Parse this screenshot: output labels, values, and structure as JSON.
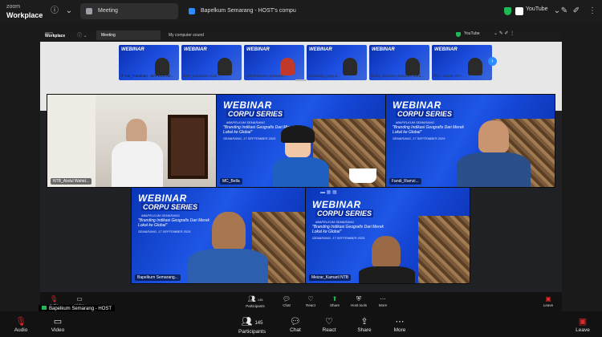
{
  "app": {
    "brand_line1": "zoom",
    "brand_line2": "Workplace"
  },
  "tabs": [
    {
      "label": "Meeting"
    },
    {
      "label": "Bapelkum Semarang - HOST's compu"
    }
  ],
  "topright": {
    "youtube": "YouTube"
  },
  "inner": {
    "brand_line1": "zoom",
    "brand_line2": "Workplace",
    "tab_meeting": "Meeting",
    "tab_screen": "My computer sound",
    "youtube": "YouTube"
  },
  "filmstrip": {
    "names": [
      "IT Gal_Frandrian - BAPELKUM...",
      "NTB_Kurniaban Sule...",
      "Luth Rahman-Sulawesi...",
      "Semarang_Bagus...",
      "Budhi_Satrianto-Sulawesi Bara...",
      "Pho - Kawan DIY..."
    ]
  },
  "webinar": {
    "title": "WEBINAR",
    "series": "CORPU SERIES",
    "org": "#BAPELKUM SEMARANG",
    "topic": "\"Branding Indikasi Geografis Dari Merek Lokal ke Global\"",
    "date": "SEMARANG, 17 SEPTEMBER 2025"
  },
  "tiles": [
    {
      "name": "NTB_Abdul Wahid..."
    },
    {
      "name": "MC_Bella"
    },
    {
      "name": "Fandi_Ramzi..."
    },
    {
      "name": "Bapelkum Semarang..."
    },
    {
      "name": "Meizar_Kamaril NTB"
    }
  ],
  "inner_controls": {
    "audio": "Audio",
    "video": "Video",
    "participants": "Participants",
    "participants_count": "145",
    "chat": "Chat",
    "react": "React",
    "share": "Share",
    "host_tools": "Host tools",
    "more": "More",
    "leave": "Leave"
  },
  "sharing_label": "Bapelkum Semarang - HOST",
  "controls": {
    "audio": "Audio",
    "video": "Video",
    "participants": "Participants",
    "participants_count": "145",
    "chat": "Chat",
    "react": "React",
    "share": "Share",
    "more": "More",
    "leave": "Leave"
  },
  "colors": {
    "accent": "#1e56e6",
    "leave": "#e02828",
    "online": "#1db954"
  }
}
